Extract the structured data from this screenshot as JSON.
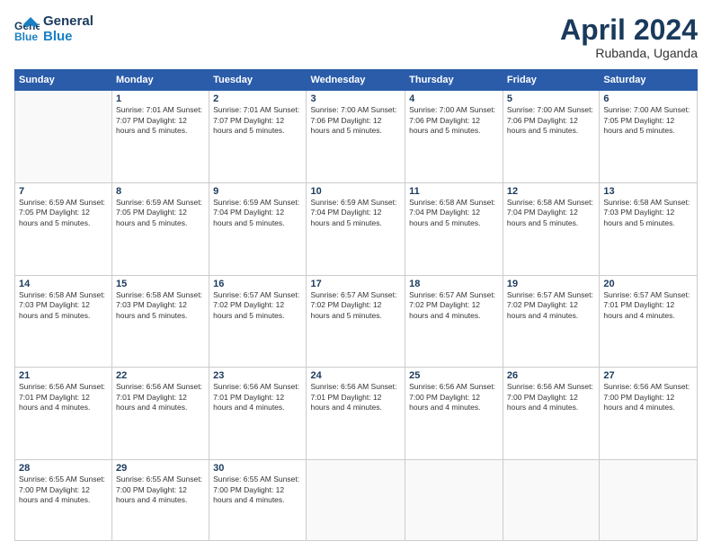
{
  "header": {
    "logo_line1": "General",
    "logo_line2": "Blue",
    "title": "April 2024",
    "location": "Rubanda, Uganda"
  },
  "days_of_week": [
    "Sunday",
    "Monday",
    "Tuesday",
    "Wednesday",
    "Thursday",
    "Friday",
    "Saturday"
  ],
  "weeks": [
    [
      {
        "num": "",
        "info": ""
      },
      {
        "num": "1",
        "info": "Sunrise: 7:01 AM\nSunset: 7:07 PM\nDaylight: 12 hours\nand 5 minutes."
      },
      {
        "num": "2",
        "info": "Sunrise: 7:01 AM\nSunset: 7:07 PM\nDaylight: 12 hours\nand 5 minutes."
      },
      {
        "num": "3",
        "info": "Sunrise: 7:00 AM\nSunset: 7:06 PM\nDaylight: 12 hours\nand 5 minutes."
      },
      {
        "num": "4",
        "info": "Sunrise: 7:00 AM\nSunset: 7:06 PM\nDaylight: 12 hours\nand 5 minutes."
      },
      {
        "num": "5",
        "info": "Sunrise: 7:00 AM\nSunset: 7:06 PM\nDaylight: 12 hours\nand 5 minutes."
      },
      {
        "num": "6",
        "info": "Sunrise: 7:00 AM\nSunset: 7:05 PM\nDaylight: 12 hours\nand 5 minutes."
      }
    ],
    [
      {
        "num": "7",
        "info": "Sunrise: 6:59 AM\nSunset: 7:05 PM\nDaylight: 12 hours\nand 5 minutes."
      },
      {
        "num": "8",
        "info": "Sunrise: 6:59 AM\nSunset: 7:05 PM\nDaylight: 12 hours\nand 5 minutes."
      },
      {
        "num": "9",
        "info": "Sunrise: 6:59 AM\nSunset: 7:04 PM\nDaylight: 12 hours\nand 5 minutes."
      },
      {
        "num": "10",
        "info": "Sunrise: 6:59 AM\nSunset: 7:04 PM\nDaylight: 12 hours\nand 5 minutes."
      },
      {
        "num": "11",
        "info": "Sunrise: 6:58 AM\nSunset: 7:04 PM\nDaylight: 12 hours\nand 5 minutes."
      },
      {
        "num": "12",
        "info": "Sunrise: 6:58 AM\nSunset: 7:04 PM\nDaylight: 12 hours\nand 5 minutes."
      },
      {
        "num": "13",
        "info": "Sunrise: 6:58 AM\nSunset: 7:03 PM\nDaylight: 12 hours\nand 5 minutes."
      }
    ],
    [
      {
        "num": "14",
        "info": "Sunrise: 6:58 AM\nSunset: 7:03 PM\nDaylight: 12 hours\nand 5 minutes."
      },
      {
        "num": "15",
        "info": "Sunrise: 6:58 AM\nSunset: 7:03 PM\nDaylight: 12 hours\nand 5 minutes."
      },
      {
        "num": "16",
        "info": "Sunrise: 6:57 AM\nSunset: 7:02 PM\nDaylight: 12 hours\nand 5 minutes."
      },
      {
        "num": "17",
        "info": "Sunrise: 6:57 AM\nSunset: 7:02 PM\nDaylight: 12 hours\nand 5 minutes."
      },
      {
        "num": "18",
        "info": "Sunrise: 6:57 AM\nSunset: 7:02 PM\nDaylight: 12 hours\nand 4 minutes."
      },
      {
        "num": "19",
        "info": "Sunrise: 6:57 AM\nSunset: 7:02 PM\nDaylight: 12 hours\nand 4 minutes."
      },
      {
        "num": "20",
        "info": "Sunrise: 6:57 AM\nSunset: 7:01 PM\nDaylight: 12 hours\nand 4 minutes."
      }
    ],
    [
      {
        "num": "21",
        "info": "Sunrise: 6:56 AM\nSunset: 7:01 PM\nDaylight: 12 hours\nand 4 minutes."
      },
      {
        "num": "22",
        "info": "Sunrise: 6:56 AM\nSunset: 7:01 PM\nDaylight: 12 hours\nand 4 minutes."
      },
      {
        "num": "23",
        "info": "Sunrise: 6:56 AM\nSunset: 7:01 PM\nDaylight: 12 hours\nand 4 minutes."
      },
      {
        "num": "24",
        "info": "Sunrise: 6:56 AM\nSunset: 7:01 PM\nDaylight: 12 hours\nand 4 minutes."
      },
      {
        "num": "25",
        "info": "Sunrise: 6:56 AM\nSunset: 7:00 PM\nDaylight: 12 hours\nand 4 minutes."
      },
      {
        "num": "26",
        "info": "Sunrise: 6:56 AM\nSunset: 7:00 PM\nDaylight: 12 hours\nand 4 minutes."
      },
      {
        "num": "27",
        "info": "Sunrise: 6:56 AM\nSunset: 7:00 PM\nDaylight: 12 hours\nand 4 minutes."
      }
    ],
    [
      {
        "num": "28",
        "info": "Sunrise: 6:55 AM\nSunset: 7:00 PM\nDaylight: 12 hours\nand 4 minutes."
      },
      {
        "num": "29",
        "info": "Sunrise: 6:55 AM\nSunset: 7:00 PM\nDaylight: 12 hours\nand 4 minutes."
      },
      {
        "num": "30",
        "info": "Sunrise: 6:55 AM\nSunset: 7:00 PM\nDaylight: 12 hours\nand 4 minutes."
      },
      {
        "num": "",
        "info": ""
      },
      {
        "num": "",
        "info": ""
      },
      {
        "num": "",
        "info": ""
      },
      {
        "num": "",
        "info": ""
      }
    ]
  ]
}
